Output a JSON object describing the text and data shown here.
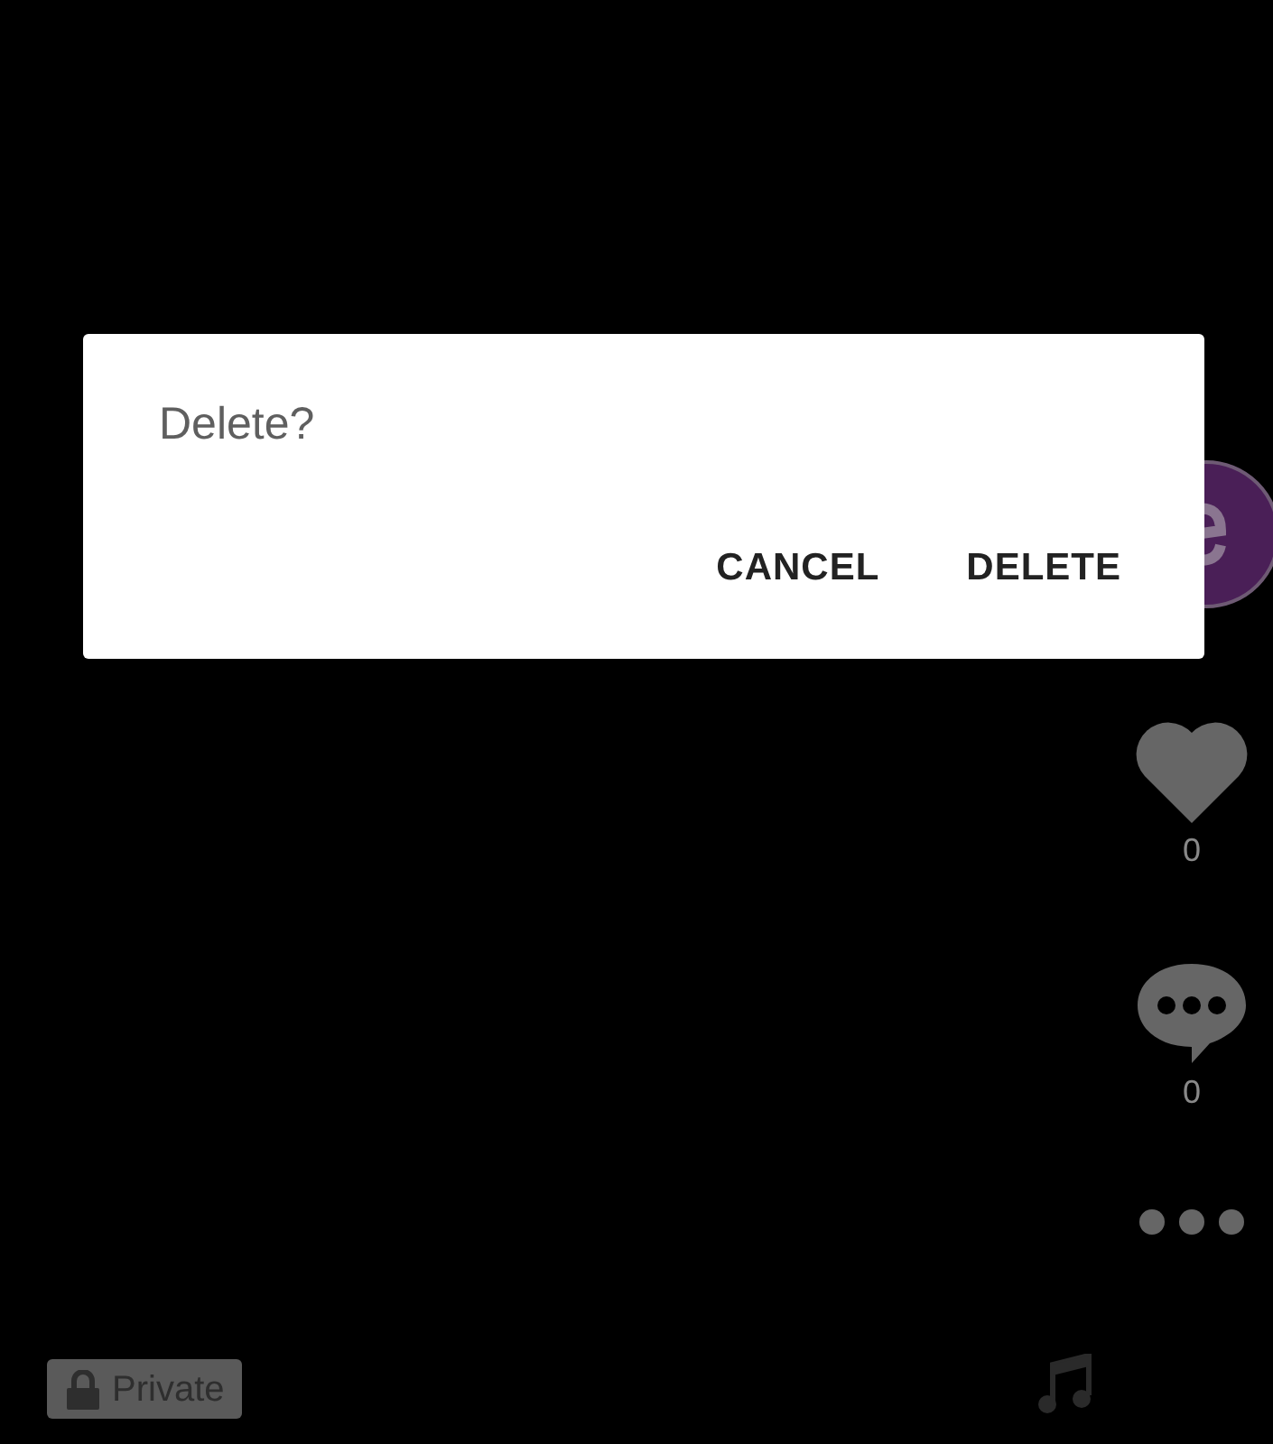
{
  "side_actions": [
    {
      "kind": "like",
      "count": "0"
    },
    {
      "kind": "comment",
      "count": "0"
    },
    {
      "kind": "more"
    }
  ],
  "privacy_badge": {
    "label": "Private"
  },
  "dialog": {
    "title": "Delete?",
    "buttons": [
      "CANCEL",
      "DELETE"
    ]
  }
}
